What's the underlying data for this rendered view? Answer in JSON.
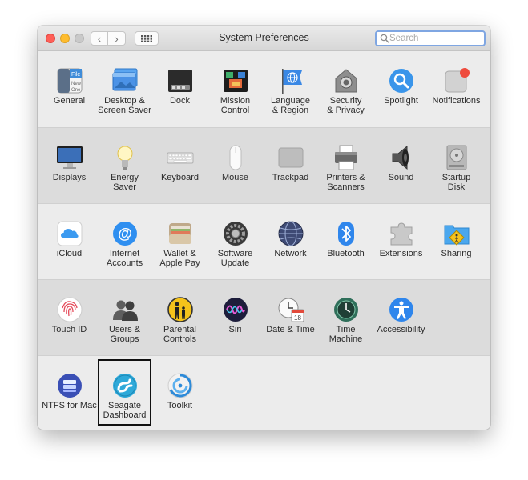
{
  "window": {
    "title": "System Preferences"
  },
  "search": {
    "placeholder": "Search"
  },
  "nav": {
    "back": "‹",
    "forward": "›"
  },
  "rows": [
    {
      "items": [
        {
          "label": "General",
          "icon": "general-icon"
        },
        {
          "label": "Desktop &\nScreen Saver",
          "icon": "desktop-screen-saver-icon"
        },
        {
          "label": "Dock",
          "icon": "dock-icon"
        },
        {
          "label": "Mission\nControl",
          "icon": "mission-control-icon"
        },
        {
          "label": "Language\n& Region",
          "icon": "language-region-icon"
        },
        {
          "label": "Security\n& Privacy",
          "icon": "security-privacy-icon"
        },
        {
          "label": "Spotlight",
          "icon": "spotlight-icon"
        },
        {
          "label": "Notifications",
          "icon": "notifications-icon"
        }
      ]
    },
    {
      "items": [
        {
          "label": "Displays",
          "icon": "displays-icon"
        },
        {
          "label": "Energy\nSaver",
          "icon": "energy-saver-icon"
        },
        {
          "label": "Keyboard",
          "icon": "keyboard-icon"
        },
        {
          "label": "Mouse",
          "icon": "mouse-icon"
        },
        {
          "label": "Trackpad",
          "icon": "trackpad-icon"
        },
        {
          "label": "Printers &\nScanners",
          "icon": "printers-scanners-icon"
        },
        {
          "label": "Sound",
          "icon": "sound-icon"
        },
        {
          "label": "Startup\nDisk",
          "icon": "startup-disk-icon"
        }
      ]
    },
    {
      "items": [
        {
          "label": "iCloud",
          "icon": "icloud-icon"
        },
        {
          "label": "Internet\nAccounts",
          "icon": "internet-accounts-icon"
        },
        {
          "label": "Wallet &\nApple Pay",
          "icon": "wallet-apple-pay-icon"
        },
        {
          "label": "Software\nUpdate",
          "icon": "software-update-icon"
        },
        {
          "label": "Network",
          "icon": "network-icon"
        },
        {
          "label": "Bluetooth",
          "icon": "bluetooth-icon"
        },
        {
          "label": "Extensions",
          "icon": "extensions-icon"
        },
        {
          "label": "Sharing",
          "icon": "sharing-icon"
        }
      ]
    },
    {
      "items": [
        {
          "label": "Touch ID",
          "icon": "touch-id-icon"
        },
        {
          "label": "Users &\nGroups",
          "icon": "users-groups-icon"
        },
        {
          "label": "Parental\nControls",
          "icon": "parental-controls-icon"
        },
        {
          "label": "Siri",
          "icon": "siri-icon"
        },
        {
          "label": "Date & Time",
          "icon": "date-time-icon"
        },
        {
          "label": "Time\nMachine",
          "icon": "time-machine-icon"
        },
        {
          "label": "Accessibility",
          "icon": "accessibility-icon"
        }
      ]
    },
    {
      "items": [
        {
          "label": "NTFS for Mac",
          "icon": "ntfs-for-mac-icon"
        },
        {
          "label": "Seagate\nDashboard",
          "icon": "seagate-dashboard-icon",
          "selected": true
        },
        {
          "label": "Toolkit",
          "icon": "toolkit-icon"
        }
      ]
    }
  ],
  "date_icon": {
    "month": "JUL",
    "day": "18"
  },
  "colors": {
    "accent": "#1e7cf2",
    "selection_border": "#111111",
    "search_focus": "#7fa6e2"
  }
}
